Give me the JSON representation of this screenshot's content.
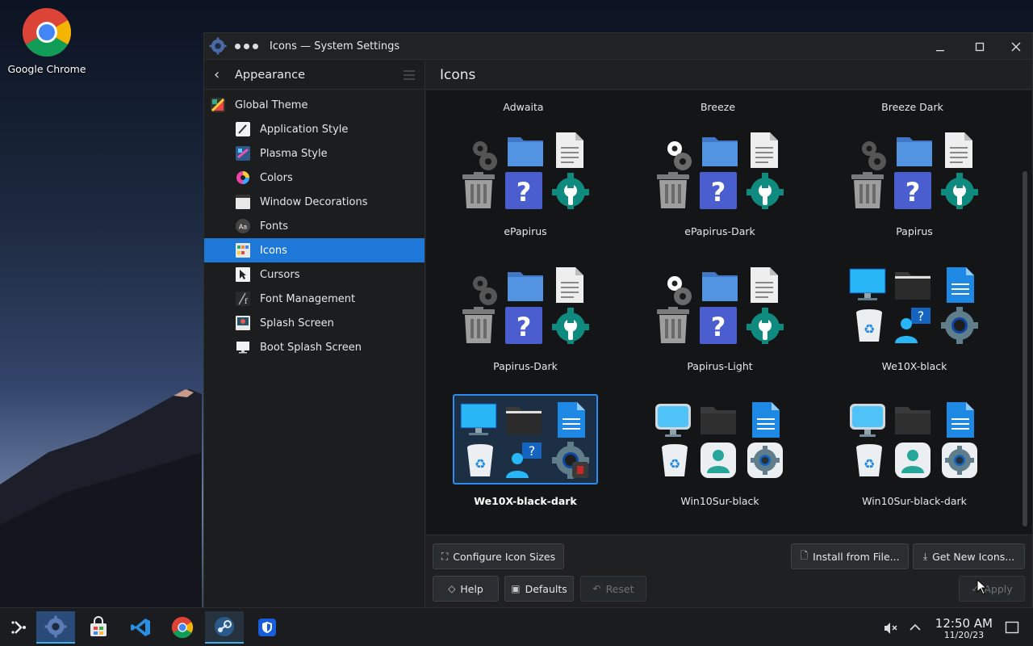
{
  "desktop": {
    "icon_label": "Google Chrome"
  },
  "window": {
    "title": "Icons — System Settings",
    "controls": [
      "minimize-icon",
      "maximize-icon",
      "close-icon"
    ]
  },
  "sidebar": {
    "breadcrumb": "Appearance",
    "items": [
      {
        "label": "Global Theme",
        "level": "top"
      },
      {
        "label": "Application Style",
        "level": "child"
      },
      {
        "label": "Plasma Style",
        "level": "child"
      },
      {
        "label": "Colors",
        "level": "child"
      },
      {
        "label": "Window Decorations",
        "level": "child"
      },
      {
        "label": "Fonts",
        "level": "child"
      },
      {
        "label": "Icons",
        "level": "child",
        "active": true
      },
      {
        "label": "Cursors",
        "level": "child"
      },
      {
        "label": "Font Management",
        "level": "child"
      },
      {
        "label": "Splash Screen",
        "level": "child"
      },
      {
        "label": "Boot Splash Screen",
        "level": "child"
      }
    ]
  },
  "main": {
    "title": "Icons",
    "top_row_labels": [
      "Adwaita",
      "Breeze",
      "Breeze Dark"
    ],
    "themes": [
      {
        "name": "ePapirus",
        "style": "papirus"
      },
      {
        "name": "ePapirus-Dark",
        "style": "papirus-dark"
      },
      {
        "name": "Papirus",
        "style": "papirus"
      },
      {
        "name": "Papirus-Dark",
        "style": "papirus"
      },
      {
        "name": "Papirus-Light",
        "style": "papirus-dark"
      },
      {
        "name": "We10X-black",
        "style": "we10x"
      },
      {
        "name": "We10X-black-dark",
        "style": "we10x",
        "selected": true
      },
      {
        "name": "Win10Sur-black",
        "style": "win10sur"
      },
      {
        "name": "Win10Sur-black-dark",
        "style": "win10sur"
      }
    ],
    "buttons": {
      "configure_sizes": "Configure Icon Sizes",
      "install_from_file": "Install from File...",
      "get_new_icons": "Get New Icons...",
      "help": "Help",
      "defaults": "Defaults",
      "reset": "Reset",
      "apply": "Apply"
    }
  },
  "taskbar": {
    "time": "12:50 AM",
    "date": "11/20/23"
  },
  "colors": {
    "accent": "#1d78d8",
    "selection_border": "#2d8cf0",
    "papirus_blue_folder": "#5294e2",
    "papirus_help": "#4a5ed0",
    "papirus_teal": "#0e8a7e",
    "we10x_blue": "#1e88e5"
  }
}
